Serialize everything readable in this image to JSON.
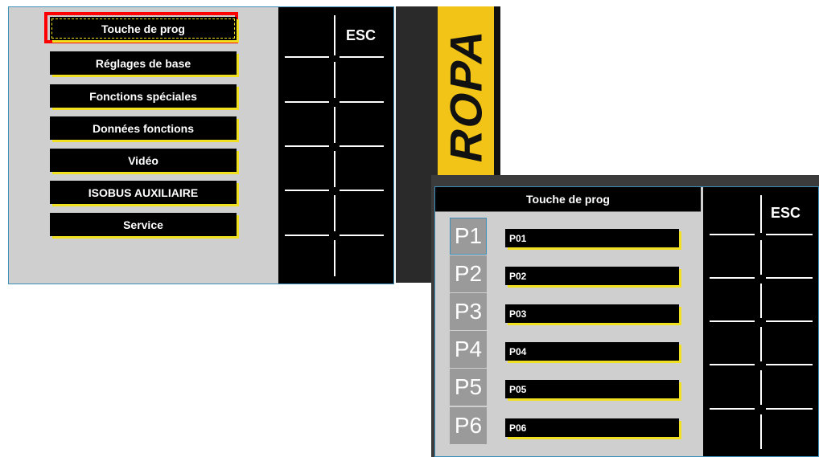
{
  "main_menu": {
    "items": [
      {
        "label": "Touche de prog",
        "selected": true
      },
      {
        "label": "Réglages de base"
      },
      {
        "label": "Fonctions spéciales"
      },
      {
        "label": "Données fonctions"
      },
      {
        "label": "Vidéo"
      },
      {
        "label": "ISOBUS AUXILIAIRE"
      },
      {
        "label": "Service"
      }
    ],
    "esc_label": "ESC"
  },
  "brand": {
    "logo_text": "ROPA",
    "band_color": "#f2c418"
  },
  "prog_screen": {
    "title": "Touche de prog",
    "esc_label": "ESC",
    "slots": [
      {
        "key": "P1",
        "value": "P01",
        "active": true
      },
      {
        "key": "P2",
        "value": "P02"
      },
      {
        "key": "P3",
        "value": "P03"
      },
      {
        "key": "P4",
        "value": "P04"
      },
      {
        "key": "P5",
        "value": "P05"
      },
      {
        "key": "P6",
        "value": "P06"
      }
    ]
  },
  "colors": {
    "highlight_frame": "#ff0000",
    "button_shadow": "#f0e020",
    "screen_border": "#3b8fb8"
  }
}
